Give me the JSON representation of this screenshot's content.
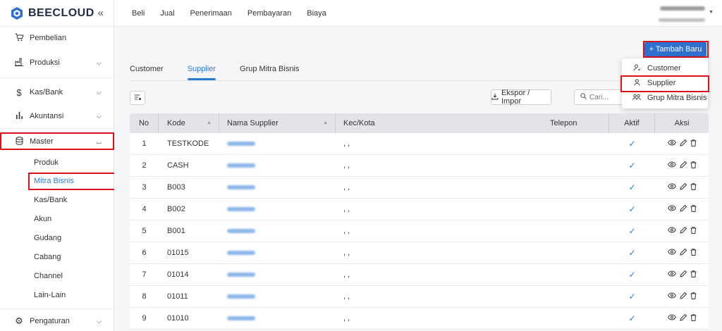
{
  "brand": {
    "name": "BEECLOUD",
    "collapse_icon": "double-chevron-left-icon"
  },
  "sidebar": {
    "items": [
      {
        "label": "Pembelian",
        "icon": "cart-icon"
      },
      {
        "label": "Produksi",
        "icon": "factory-icon"
      },
      {
        "label": "Kas/Bank",
        "icon": "dollar-icon"
      },
      {
        "label": "Akuntansi",
        "icon": "bar-chart-icon"
      },
      {
        "label": "Master",
        "icon": "database-icon"
      },
      {
        "label": "Pengaturan",
        "icon": "gear-icon"
      }
    ],
    "master_sub": [
      "Produk",
      "Mitra Bisnis",
      "Kas/Bank",
      "Akun",
      "Gudang",
      "Cabang",
      "Channel",
      "Lain-Lain"
    ],
    "active_sub": "Mitra Bisnis"
  },
  "topnav": {
    "links": [
      "Beli",
      "Jual",
      "Penerimaan",
      "Pembayaran",
      "Biaya"
    ]
  },
  "toolbar": {
    "add_label": "+ Tambah Baru",
    "export_label": "Ekspor / Impor",
    "search_placeholder": "Cari..."
  },
  "tabs": [
    "Customer",
    "Supplier",
    "Grup Mitra Bisnis"
  ],
  "active_tab": "Supplier",
  "dropdown": {
    "items": [
      {
        "label": "Customer",
        "icon": "user-icon"
      },
      {
        "label": "Supplier",
        "icon": "user-icon"
      },
      {
        "label": "Grup Mitra Bisnis",
        "icon": "users-icon"
      }
    ]
  },
  "table": {
    "headers": {
      "no": "No",
      "kode": "Kode",
      "nama": "Nama Supplier",
      "kec": "Kec/Kota",
      "tel": "Telepon",
      "aktif": "Aktif",
      "aksi": "Aksi"
    },
    "rows": [
      {
        "no": "1",
        "kode": "TESTKODE",
        "kec": ", ,"
      },
      {
        "no": "2",
        "kode": "CASH",
        "kec": ", ,"
      },
      {
        "no": "3",
        "kode": "B003",
        "kec": ", ,"
      },
      {
        "no": "4",
        "kode": "B002",
        "kec": ", ,"
      },
      {
        "no": "5",
        "kode": "B001",
        "kec": ", ,"
      },
      {
        "no": "6",
        "kode": "01015",
        "kec": ", ,"
      },
      {
        "no": "7",
        "kode": "01014",
        "kec": ", ,"
      },
      {
        "no": "8",
        "kode": "01011",
        "kec": ", ,"
      },
      {
        "no": "9",
        "kode": "01010",
        "kec": ", ,"
      }
    ]
  },
  "colors": {
    "accent": "#2b7bd6",
    "primary_button": "#2f6fcf",
    "highlight": "#d8131b",
    "header_bg": "#e3e4e7"
  }
}
